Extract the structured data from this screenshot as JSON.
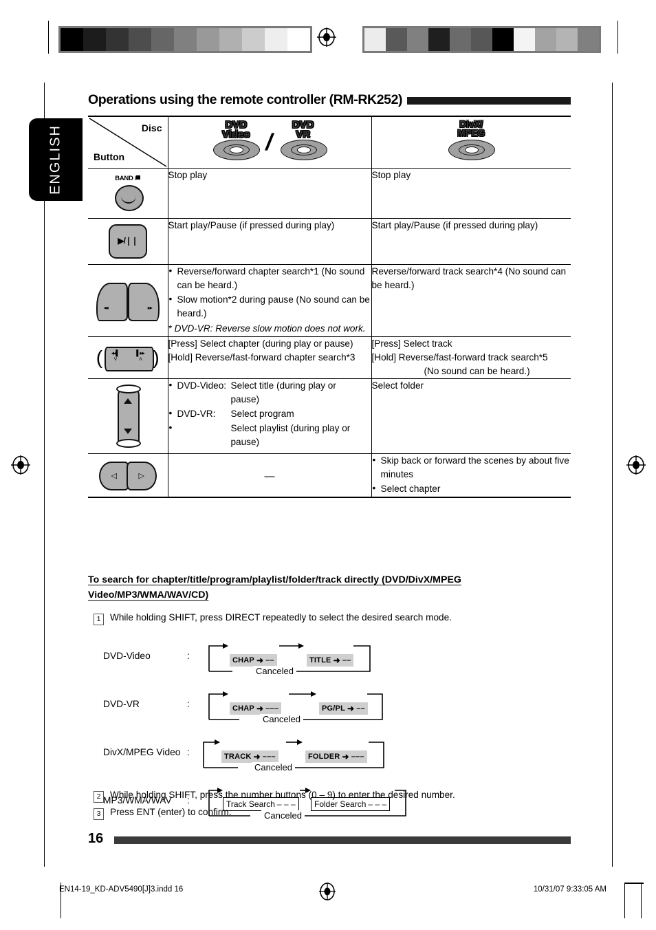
{
  "language_tab": "ENGLISH",
  "header": {
    "title": "Operations using the remote controller (RM-RK252)"
  },
  "table": {
    "corner": {
      "disc_label": "Disc",
      "button_label": "Button"
    },
    "columns": [
      {
        "name": "dvd-video-vr",
        "discs": [
          {
            "line1": "DVD",
            "line2": "Video"
          },
          {
            "line1": "DVD",
            "line2": "VR"
          }
        ],
        "separator": "/"
      },
      {
        "name": "divx-mpeg",
        "discs": [
          {
            "line1": "DivX/",
            "line2": "MPEG"
          }
        ]
      }
    ],
    "rows": [
      {
        "button": "band-stop-button",
        "button_label": "BAND /",
        "dvd": [
          "Stop play"
        ],
        "divx": [
          "Stop play"
        ]
      },
      {
        "button": "play-pause-button",
        "button_label": "▶/❘❘",
        "dvd": [
          "Start play/Pause (if pressed during play)"
        ],
        "divx": [
          "Start play/Pause (if pressed during play)"
        ]
      },
      {
        "button": "reverse-forward-wing-buttons",
        "dvd_bullets": [
          "Reverse/forward chapter search*1 (No sound can be heard.)",
          "Slow motion*2 during pause (No sound can be heard.)"
        ],
        "dvd_note": "* DVD-VR: Reverse slow motion does not work.",
        "divx": [
          "Reverse/forward track search*4 (No sound can be heard.)"
        ]
      },
      {
        "button": "skip-search-buttons",
        "dvd_lines": [
          "[Press] Select chapter (during play or pause)",
          "[Hold]  Reverse/fast-forward chapter search*3"
        ],
        "divx_lines": [
          "[Press] Select track",
          "[Hold]  Reverse/fast-forward track search*5",
          "(No sound can be heard.)"
        ]
      },
      {
        "button": "up-down-buttons",
        "dvd_items": [
          {
            "label": "DVD-Video:",
            "text": "Select title (during play or pause)"
          },
          {
            "label": "DVD-VR:",
            "text": "Select program"
          },
          {
            "label": "",
            "text": "Select playlist (during play or pause)"
          }
        ],
        "divx": [
          "Select folder"
        ]
      },
      {
        "button": "left-right-buttons",
        "dvd_dash": "—",
        "divx_bullets": [
          "Skip back or forward the scenes by about five minutes",
          "Select chapter"
        ]
      }
    ]
  },
  "section": {
    "title": "To search for chapter/title/program/playlist/folder/track directly (DVD/DivX/MPEG Video/MP3/WMA/WAV/CD)",
    "steps": [
      {
        "num": "1",
        "text": "While holding SHIFT, press DIRECT repeatedly to select the desired search mode."
      },
      {
        "num": "2",
        "text": "While holding SHIFT, press the number buttons (0 – 9) to enter the desired number."
      },
      {
        "num": "3",
        "text": "Press ENT (enter) to confirm."
      }
    ],
    "diagrams": [
      {
        "label": "DVD-Video",
        "colon": ":",
        "nodes": [
          {
            "text": "CHAP",
            "arrow": "➜",
            "dashes": "––",
            "boxed": false
          },
          {
            "text": "TITLE",
            "arrow": "➜",
            "dashes": "––",
            "boxed": false
          }
        ],
        "cancel": "Canceled"
      },
      {
        "label": "DVD-VR",
        "colon": ":",
        "nodes": [
          {
            "text": "CHAP",
            "arrow": "➜",
            "dashes": "–––",
            "boxed": false
          },
          {
            "text": "PG/PL",
            "arrow": "➜",
            "dashes": "––",
            "boxed": false
          }
        ],
        "cancel": "Canceled"
      },
      {
        "label": "DivX/MPEG Video",
        "colon": ":",
        "nodes": [
          {
            "text": "TRACK",
            "arrow": "➜",
            "dashes": "–––",
            "boxed": false
          },
          {
            "text": "FOLDER",
            "arrow": "➜",
            "dashes": "–––",
            "boxed": false
          }
        ],
        "cancel": "Canceled"
      },
      {
        "label": "MP3/WMA/WAV",
        "colon": ":",
        "nodes": [
          {
            "text": "Track Search",
            "arrow": "",
            "dashes": "– – –",
            "boxed": true
          },
          {
            "text": "Folder Search",
            "arrow": "",
            "dashes": "– – –",
            "boxed": true
          }
        ],
        "cancel": "Canceled"
      }
    ]
  },
  "page_number": "16",
  "footer": {
    "file": "EN14-19_KD-ADV5490[J]3.indd   16",
    "timestamp": "10/31/07   9:33:05 AM"
  },
  "wedge_left": [
    "#000000",
    "#1c1c1c",
    "#333333",
    "#4d4d4d",
    "#666666",
    "#808080",
    "#999999",
    "#b0b0b0",
    "#cccccc",
    "#eeeeee",
    "#ffffff"
  ],
  "wedge_right": [
    "#ececec",
    "#595959",
    "#808080",
    "#1f1f1f",
    "#6b6b6b",
    "#575757",
    "#000000",
    "#f4f4f4",
    "#a3a3a3",
    "#b4b4b4",
    "#808080"
  ]
}
